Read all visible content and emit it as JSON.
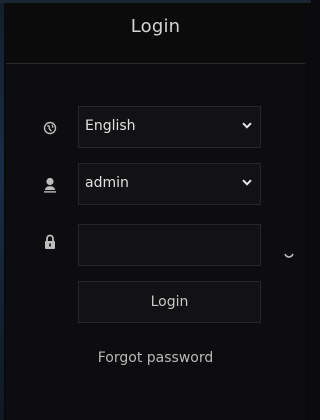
{
  "dialog": {
    "title": "Login"
  },
  "language": {
    "icon": "globe-icon",
    "selected": "English"
  },
  "user": {
    "icon": "user-icon",
    "selected": "admin"
  },
  "password": {
    "icon": "lock-icon",
    "value": "",
    "placeholder": "",
    "toggle_icon": "eye-closed-icon"
  },
  "actions": {
    "login_label": "Login",
    "forgot_label": "Forgot password"
  }
}
